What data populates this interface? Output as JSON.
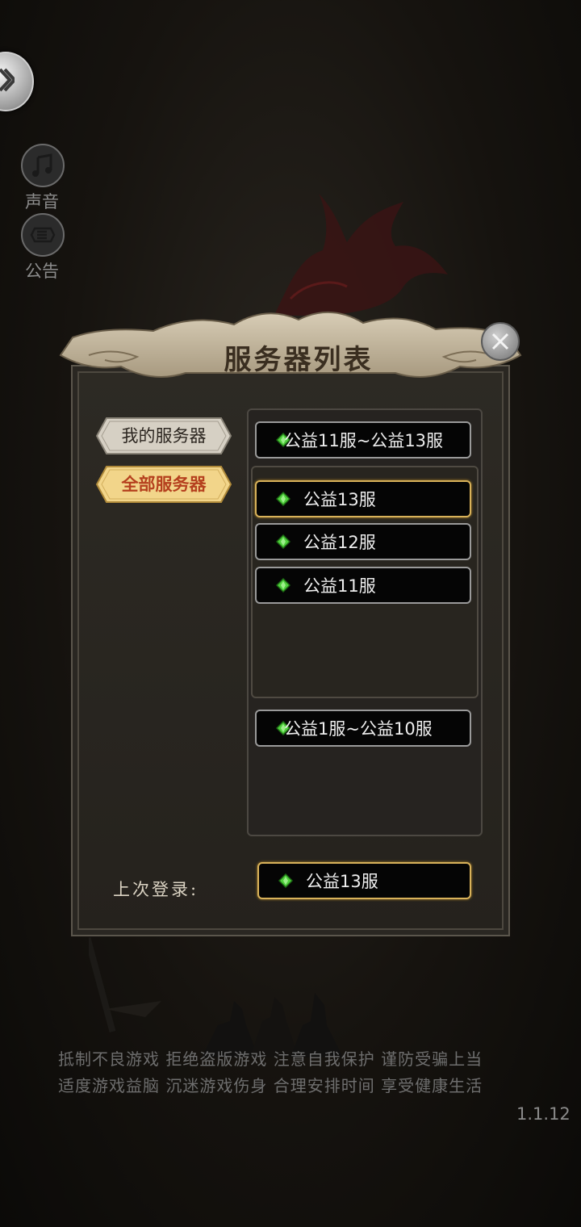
{
  "side": {
    "sound_label": "声音",
    "notice_label": "公告"
  },
  "dialog": {
    "title": "服务器列表",
    "tabs": {
      "mine": "我的服务器",
      "all": "全部服务器"
    },
    "groups": [
      {
        "label": "公益11服~公益13服",
        "servers": [
          "公益13服",
          "公益12服",
          "公益11服"
        ]
      },
      {
        "label": "公益1服~公益10服"
      }
    ],
    "last_login_label": "上次登录:",
    "last_login_server": "公益13服"
  },
  "footer": {
    "line1": "抵制不良游戏 拒绝盗版游戏 注意自我保护 谨防受骗上当",
    "line2": "适度游戏益脑 沉迷游戏伤身 合理安排时间 享受健康生活",
    "version": "1.1.12"
  },
  "colors": {
    "selected_border": "#d9b25a",
    "gem": "#4fcf3c",
    "tab_active_text": "#b5401e"
  },
  "icons": [
    "back-arrow-icon",
    "music-note-icon",
    "notice-icon",
    "close-icon",
    "green-gem-icon"
  ]
}
